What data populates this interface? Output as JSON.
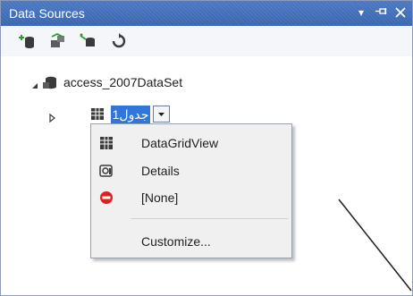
{
  "window": {
    "title": "Data Sources",
    "title_icons": [
      "dropdown-arrow-icon",
      "pin-icon",
      "close-icon"
    ]
  },
  "toolbar": {
    "buttons": [
      {
        "name": "add-new-data-source-icon"
      },
      {
        "name": "edit-dataset-with-designer-icon"
      },
      {
        "name": "configure-dataset-with-wizard-icon"
      },
      {
        "name": "refresh-icon"
      }
    ]
  },
  "tree": {
    "root": {
      "label": "access_2007DataSet",
      "expanded": true
    },
    "child": {
      "label": "جدول1",
      "expanded": false,
      "selected": true
    }
  },
  "menu": {
    "items": [
      {
        "label": "DataGridView",
        "icon": "datagridview-icon"
      },
      {
        "label": "Details",
        "icon": "details-icon"
      },
      {
        "label": "[None]",
        "icon": "none-icon"
      },
      {
        "label": "Customize...",
        "icon": ""
      }
    ]
  },
  "colors": {
    "titlebar": "#3f6bb2",
    "selection": "#3176d9",
    "menu_bg": "#f0f0f0"
  }
}
